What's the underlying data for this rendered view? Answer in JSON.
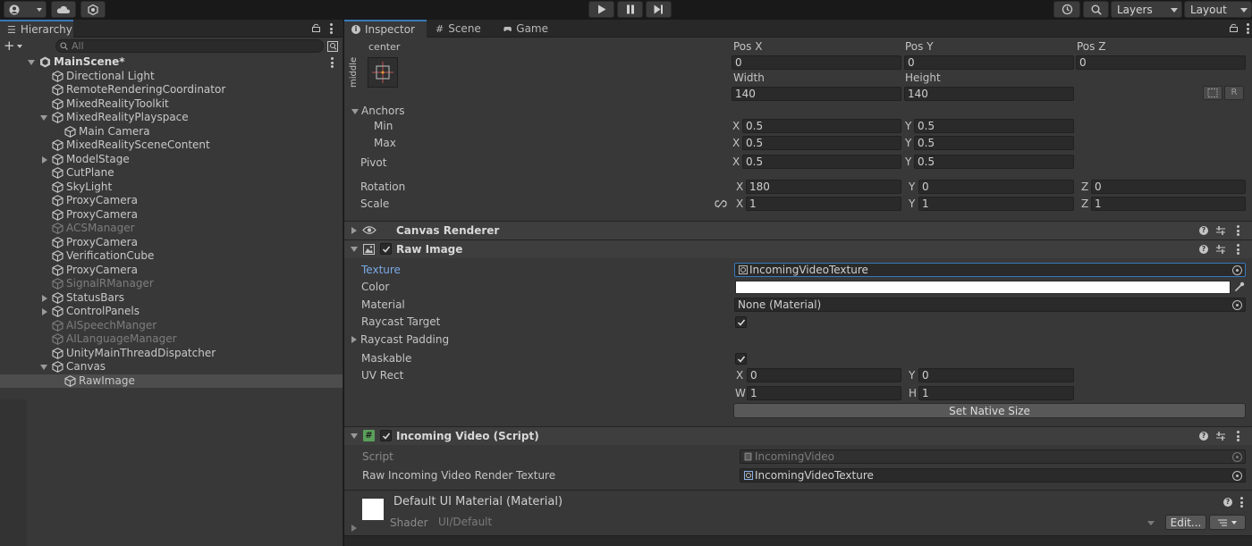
{
  "toolbar": {
    "account_label": "",
    "layers_label": "Layers",
    "layout_label": "Layout"
  },
  "hierarchy": {
    "tab_label": "Hierarchy",
    "search_placeholder": "All",
    "items": [
      {
        "label": "MainScene*",
        "depth": 0,
        "fold": "open",
        "kind": "scene"
      },
      {
        "label": "Directional Light",
        "depth": 1,
        "fold": "none",
        "kind": "object"
      },
      {
        "label": "RemoteRenderingCoordinator",
        "depth": 1,
        "fold": "none",
        "kind": "object"
      },
      {
        "label": "MixedRealityToolkit",
        "depth": 1,
        "fold": "none",
        "kind": "object"
      },
      {
        "label": "MixedRealityPlayspace",
        "depth": 1,
        "fold": "open",
        "kind": "object"
      },
      {
        "label": "Main Camera",
        "depth": 2,
        "fold": "none",
        "kind": "object"
      },
      {
        "label": "MixedRealitySceneContent",
        "depth": 1,
        "fold": "none",
        "kind": "object"
      },
      {
        "label": "ModelStage",
        "depth": 1,
        "fold": "closed",
        "kind": "object"
      },
      {
        "label": "CutPlane",
        "depth": 1,
        "fold": "none",
        "kind": "object"
      },
      {
        "label": "SkyLight",
        "depth": 1,
        "fold": "none",
        "kind": "object"
      },
      {
        "label": "ProxyCamera",
        "depth": 1,
        "fold": "none",
        "kind": "object"
      },
      {
        "label": "ProxyCamera",
        "depth": 1,
        "fold": "none",
        "kind": "object"
      },
      {
        "label": "ACSManager",
        "depth": 1,
        "fold": "none",
        "kind": "object",
        "disabled": true
      },
      {
        "label": "ProxyCamera",
        "depth": 1,
        "fold": "none",
        "kind": "object"
      },
      {
        "label": "VerificationCube",
        "depth": 1,
        "fold": "none",
        "kind": "object"
      },
      {
        "label": "ProxyCamera",
        "depth": 1,
        "fold": "none",
        "kind": "object"
      },
      {
        "label": "SignalRManager",
        "depth": 1,
        "fold": "none",
        "kind": "object",
        "disabled": true
      },
      {
        "label": "StatusBars",
        "depth": 1,
        "fold": "closed",
        "kind": "object"
      },
      {
        "label": "ControlPanels",
        "depth": 1,
        "fold": "closed",
        "kind": "object"
      },
      {
        "label": "AISpeechManger",
        "depth": 1,
        "fold": "none",
        "kind": "object",
        "disabled": true
      },
      {
        "label": "AILanguageManager",
        "depth": 1,
        "fold": "none",
        "kind": "object",
        "disabled": true
      },
      {
        "label": "UnityMainThreadDispatcher",
        "depth": 1,
        "fold": "none",
        "kind": "object"
      },
      {
        "label": "Canvas",
        "depth": 1,
        "fold": "open",
        "kind": "object"
      },
      {
        "label": "RawImage",
        "depth": 2,
        "fold": "none",
        "kind": "object",
        "selected": true
      }
    ]
  },
  "inspector_tabs": [
    {
      "label": "Inspector"
    },
    {
      "label": "Scene"
    },
    {
      "label": "Game"
    }
  ],
  "rect_transform": {
    "anchor_h": "center",
    "anchor_v": "middle",
    "pos_x_label": "Pos X",
    "pos_y_label": "Pos Y",
    "pos_z_label": "Pos Z",
    "pos_x": "0",
    "pos_y": "0",
    "pos_z": "0",
    "width_label": "Width",
    "height_label": "Height",
    "width": "140",
    "height": "140",
    "anchors_label": "Anchors",
    "min_label": "Min",
    "max_label": "Max",
    "min_x": "0.5",
    "min_y": "0.5",
    "max_x": "0.5",
    "max_y": "0.5",
    "pivot_label": "Pivot",
    "pivot_x": "0.5",
    "pivot_y": "0.5",
    "rotation_label": "Rotation",
    "rot_x": "180",
    "rot_y": "0",
    "rot_z": "0",
    "scale_label": "Scale",
    "scale_x": "1",
    "scale_y": "1",
    "scale_z": "1",
    "axis_x": "X",
    "axis_y": "Y",
    "axis_z": "Z"
  },
  "canvas_renderer": {
    "title": "Canvas Renderer"
  },
  "raw_image": {
    "title": "Raw Image",
    "texture_label": "Texture",
    "texture_value": "IncomingVideoTexture",
    "color_label": "Color",
    "color_value": "#ffffff",
    "material_label": "Material",
    "material_value": "None (Material)",
    "raycast_target_label": "Raycast Target",
    "raycast_padding_label": "Raycast Padding",
    "maskable_label": "Maskable",
    "uv_rect_label": "UV Rect",
    "uv_x": "0",
    "uv_y": "0",
    "uv_w": "1",
    "uv_h": "1",
    "axis_w": "W",
    "axis_h": "H",
    "set_native_size": "Set Native Size"
  },
  "incoming_video": {
    "title": "Incoming Video (Script)",
    "script_label": "Script",
    "script_value": "IncomingVideo",
    "rt_label": "Raw Incoming Video Render Texture",
    "rt_value": "IncomingVideoTexture"
  },
  "material": {
    "title": "Default UI Material (Material)",
    "shader_label": "Shader",
    "shader_value": "UI/Default",
    "edit_label": "Edit..."
  },
  "colors": {
    "accent": "#3a79bb",
    "panel": "#383838",
    "field": "#2a2a2a"
  }
}
